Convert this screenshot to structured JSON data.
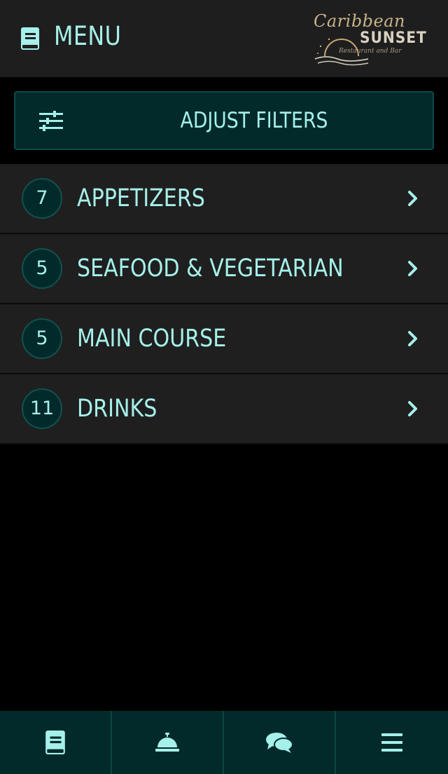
{
  "header": {
    "title": "MENU",
    "title_icon": "book-icon",
    "logo": {
      "script": "Caribbean",
      "word": "SUNSET",
      "tagline": "Restaurant and Bar"
    }
  },
  "filters": {
    "label": "ADJUST FILTERS",
    "icon": "sliders-icon"
  },
  "categories": [
    {
      "count": "7",
      "label": "APPETIZERS"
    },
    {
      "count": "5",
      "label": "SEAFOOD & VEGETARIAN"
    },
    {
      "count": "5",
      "label": "MAIN COURSE"
    },
    {
      "count": "11",
      "label": "DRINKS"
    }
  ],
  "bottom_nav": [
    {
      "name": "menu",
      "icon": "book-icon"
    },
    {
      "name": "service",
      "icon": "service-bell-icon"
    },
    {
      "name": "chat",
      "icon": "chat-bubbles-icon"
    },
    {
      "name": "more",
      "icon": "hamburger-icon"
    }
  ],
  "colors": {
    "accent": "#a6f0ea",
    "dark_teal": "#032a2b",
    "header_bg": "#1e1e1e",
    "row_bg": "#1f1f1f",
    "page_bg": "#000000"
  }
}
